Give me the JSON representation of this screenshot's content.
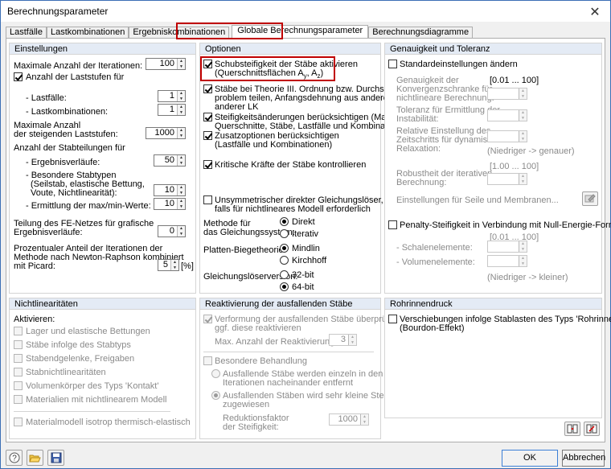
{
  "window": {
    "title": "Berechnungsparameter",
    "close_label": "✕"
  },
  "tabs": [
    "Lastfälle",
    "Lastkombinationen",
    "Ergebniskombinationen",
    "Globale Berechnungsparameter",
    "Berechnungsdiagramme"
  ],
  "einstellungen": {
    "heading": "Einstellungen",
    "max_iter_label": "Maximale Anzahl der Iterationen:",
    "max_iter_value": "100",
    "laststufen_label": "Anzahl der Laststufen für",
    "lastfaelle_label": "- Lastfälle:",
    "lastfaelle_value": "1",
    "lastkomb_label": "- Lastkombinationen:",
    "lastkomb_value": "1",
    "steigende_label1": "Maximale Anzahl",
    "steigende_label2": "der steigenden Laststufen:",
    "steigende_value": "1000",
    "stabteilungen_label": "Anzahl der Stabteilungen für",
    "ergebnis_label": "- Ergebnisverläufe:",
    "ergebnis_value": "50",
    "besondere_label1": "- Besondere Stabtypen",
    "besondere_label2": "(Seilstab, elastische Bettung,",
    "besondere_label3": "Voute, Nichtlinearität):",
    "besondere_value": "10",
    "maxmin_label": "- Ermittlung der max/min-Werte:",
    "maxmin_value": "10",
    "fe_label1": "Teilung des FE-Netzes für grafische",
    "fe_label2": "Ergebnisverläufe:",
    "fe_value": "0",
    "proz_label1": "Prozentualer Anteil der Iterationen der",
    "proz_label2": "Methode nach Newton-Raphson kombiniert",
    "proz_label3": "mit Picard:",
    "proz_value": "5",
    "proz_unit": "[%]"
  },
  "optionen": {
    "heading": "Optionen",
    "schub_label1": "Schubsteifigkeit der Stäbe aktivieren",
    "schub_label2": "(Querschnittsflächen A",
    "schub_sub_y": "y",
    "schub_sep": ", A",
    "schub_sub_z": "z",
    "schub_close": ")",
    "theorie_label1": "Stäbe bei Theorie III. Ordnung bzw. Durchschlag-",
    "theorie_label2": "problem teilen, Anfangsdehnung aus anderem LF /",
    "theorie_label3": "anderer LK",
    "steif_label1": "Steifigkeitsänderungen berücksichtigen (Materialien,",
    "steif_label2": "Querschnitte, Stäbe, Lastfälle und Kombinationen)",
    "zusatz_label1": "Zusatzoptionen berücksichtigen",
    "zusatz_label2": "(Lastfälle und Kombinationen)",
    "kritisch_label": "Kritische Kräfte der Stäbe kontrollieren",
    "unsym_label1": "Unsymmetrischer direkter Gleichungslöser,",
    "unsym_label2": "falls für nichtlineares Modell erforderlich",
    "methode_label1": "Methode für",
    "methode_label2": "das Gleichungssystem:",
    "direkt_label": "Direkt",
    "iterativ_label": "Iterativ",
    "platten_label": "Platten-Biegetheorie:",
    "mindlin_label": "Mindlin",
    "kirchhoff_label": "Kirchhoff",
    "version_label": "Gleichungslöserversion:",
    "bit32_label": "32-bit",
    "bit64_label": "64-bit"
  },
  "genauigkeit": {
    "heading": "Genauigkeit und Toleranz",
    "standard_label": "Standardeinstellungen ändern",
    "konv_label1": "Genauigkeit der",
    "konv_label2": "Konvergenzschranke für",
    "konv_label3": "nichtlineare Berechnung:",
    "konv_range": "[0.01 ... 100]",
    "tol_label1": "Toleranz für Ermittlung der",
    "tol_label2": "Instabilität:",
    "rel_label1": "Relative Einstellung des",
    "rel_label2": "Zeitschritts für dynamische",
    "rel_label3": "Relaxation:",
    "rel_hint": "(Niedriger -> genauer)",
    "rob_range": "[1.00 ... 100]",
    "rob_label1": "Robustheit der iterativen",
    "rob_label2": "Berechnung:",
    "seile_label": "Einstellungen für Seile und Membranen...",
    "penalty_label": "Penalty-Steifigkeit in Verbindung mit Null-Energie-Formen für",
    "pen_range": "[0.01 ... 100]",
    "schalen_label": "- Schalenelemente:",
    "volumen_label": "- Volumenelemente:",
    "pen_hint": "(Niedriger -> kleiner)"
  },
  "nichtlin": {
    "heading": "Nichtlinearitäten",
    "aktivieren_label": "Aktivieren:",
    "items": [
      "Lager und elastische Bettungen",
      "Stäbe infolge des Stabtyps",
      "Stabendgelenke, Freigaben",
      "Stabnichtlinearitäten",
      "Volumenkörper des Typs 'Kontakt'",
      "Materialien mit nichtlinearem Modell"
    ],
    "isotrop_label": "Materialmodell isotrop thermisch-elastisch"
  },
  "reaktivierung": {
    "heading": "Reaktivierung der ausfallenden Stäbe",
    "verf_label1": "Verformung der ausfallenden Stäbe überprüfen und",
    "verf_label2": "ggf. diese reaktivieren",
    "max_label": "Max. Anzahl der Reaktivierungen:",
    "max_value": "3",
    "besondere_label": "Besondere Behandlung",
    "einzeln_label1": "Ausfallende Stäbe werden einzeln in den jeweiligen",
    "einzeln_label2": "Iterationen nacheinander entfernt",
    "klein_label1": "Ausfallenden Stäben wird sehr kleine Steifigkeit",
    "klein_label2": "zugewiesen",
    "red_label1": "Reduktionsfaktor",
    "red_label2": "der Steifigkeit:",
    "red_value": "1000"
  },
  "rohrinnen": {
    "heading": "Rohrinnendruck",
    "label1": "Verschiebungen infolge Stablasten des Typs 'Rohrinnendruck'",
    "label2": "(Bourdon-Effekt)"
  },
  "footer": {
    "ok_label": "OK",
    "cancel_label": "Abbrechen"
  }
}
